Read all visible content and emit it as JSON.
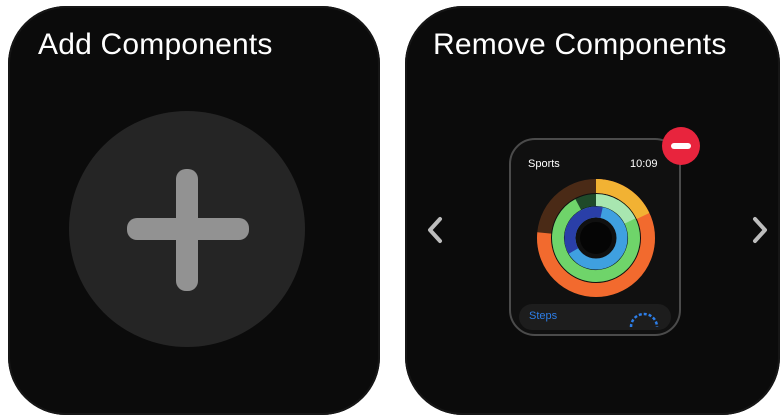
{
  "left_screen": {
    "title": "Add Components",
    "add_icon": "plus-icon"
  },
  "right_screen": {
    "title": "Remove Components",
    "card": {
      "left_label": "Sports",
      "time": "10:09",
      "steps_label": "Steps"
    },
    "remove_icon": "minus-circle-icon",
    "prev_icon": "chevron-left-icon",
    "next_icon": "chevron-right-icon"
  },
  "colors": {
    "background": "#0b0b0b",
    "plus_circle": "#252525",
    "plus_sign": "#929292",
    "remove_badge": "#e8243d",
    "steps_text": "#2d7ee8",
    "ring_outer": "#f26a2e",
    "ring_middle": "#6fd46a",
    "ring_inner": "#3fa0e0"
  }
}
